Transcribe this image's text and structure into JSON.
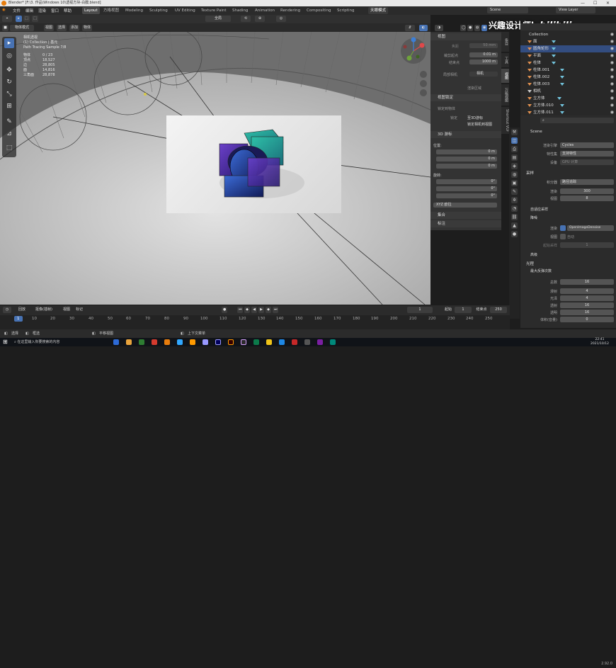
{
  "window": {
    "title": "Blender* [F:\\3. 作品\\Windows 10\\透视方块-白膜.blend]"
  },
  "menu": [
    "文件",
    "编辑",
    "渲染",
    "窗口",
    "帮助"
  ],
  "workspaces": [
    "Layout",
    "方格视图",
    "Modeling",
    "Sculpting",
    "UV Editing",
    "Texture Paint",
    "Shading",
    "Animation",
    "Rendering",
    "Compositing",
    "Scripting"
  ],
  "workspace_extra": "天眼模式",
  "scene": {
    "label": "Scene",
    "view_layer": "View Layer"
  },
  "viewport_header": {
    "mode": "物体模式",
    "view": "视图",
    "select": "选择",
    "add": "添加",
    "object": "物体",
    "orientation": "全局"
  },
  "stats": {
    "title": "相机透视",
    "collection": "(1) Collection | 基元",
    "render": "Path Tracing Sample 7/8",
    "rows": [
      {
        "k": "物体",
        "v": "0 / 23"
      },
      {
        "k": "顶点",
        "v": "18,527"
      },
      {
        "k": "边",
        "v": "28,805"
      },
      {
        "k": "面",
        "v": "14,816"
      },
      {
        "k": "三角面",
        "v": "28,878"
      }
    ]
  },
  "npanel": {
    "view_title": "视图",
    "focal_label": "焦距",
    "focal_value": "50 mm",
    "clip_start_label": "裁剪起点",
    "clip_start": "0.01 m",
    "clip_end_label": "结束点",
    "clip_end": "1000 m",
    "local_camera_label": "局部相机",
    "camera_field": "相机",
    "render_region": "渲染区域",
    "view_lock": "视图锁定",
    "lock_to_object": "锁定到物体",
    "lock_label": "锁定",
    "lock_3d_cursor": "至3D游标",
    "lock_camera_to_view": "锁定相机到视图",
    "cursor_title": "3D 游标",
    "location_label": "位置:",
    "x": "0 m",
    "y": "0 m",
    "z": "0 m",
    "rotation_label": "旋转:",
    "rx": "0°",
    "ry": "0°",
    "rz": "0°",
    "rotation_mode": "XYZ 欧拉",
    "collections": "集合",
    "annotations": "标注"
  },
  "side_tabs": [
    "条目",
    "工具",
    "视图",
    "万能视图",
    "Shortcut VUr"
  ],
  "outliner": {
    "root": "Collection",
    "items": [
      "面",
      "圆角矩形",
      "平面",
      "柱体",
      "柱体.001",
      "柱体.002",
      "柱体.003",
      "相机",
      "立方体",
      "立方体.010",
      "立方体.011"
    ]
  },
  "props": {
    "search_placeholder": "",
    "scene": "Scene",
    "render_engine_label": "渲染引擎",
    "render_engine": "Cycles",
    "feature_set_label": "特性集",
    "feature_set": "支持特性",
    "device_label": "设备",
    "device": "GPU 计算",
    "sampling": "采样",
    "integrator_label": "积分器",
    "integrator": "路径追踪",
    "render_label": "渲染",
    "render_samples": "300",
    "viewport_label": "视图",
    "viewport_samples": "8",
    "adaptive": "自适应采样",
    "denoise": "降噪",
    "denoise_render_label": "渲染",
    "denoiser": "OpenImageDenoise",
    "denoise_viewport_label": "视图",
    "denoise_viewport_field": "自动",
    "start_sample_label": "起始采样",
    "start_sample": "1",
    "advanced": "高级",
    "light_paths": "光程",
    "max_bounces": "最大反弹次数",
    "total_label": "总数",
    "total": "16",
    "diffuse_label": "漫射",
    "diffuse": "4",
    "glossy_label": "光泽",
    "glossy": "4",
    "transmission_label": "透射",
    "transmission": "16",
    "transparency_label": "透明",
    "transparency": "16",
    "volume_label": "体积(音量)",
    "volume": "0"
  },
  "timeline": {
    "playback": "回放",
    "keying": "抠像(插帧)",
    "view": "视图",
    "marker": "标记",
    "current_frame": "1",
    "start_label": "起始",
    "start": "1",
    "end_label": "结束点",
    "end": "250",
    "ticks": [
      "1",
      "10",
      "20",
      "30",
      "40",
      "50",
      "60",
      "70",
      "80",
      "90",
      "100",
      "110",
      "120",
      "130",
      "140",
      "150",
      "160",
      "170",
      "180",
      "190",
      "200",
      "210",
      "220",
      "230",
      "240",
      "250"
    ]
  },
  "statusbar": {
    "select": "选择",
    "box_select": "框选",
    "pan_view": "平移视图",
    "context_menu": "上下文菜单",
    "version": "2.92.0"
  },
  "taskbar": {
    "search": "在这里输入你要搜索的内容",
    "time": "22:41",
    "date": "2021/10/12"
  },
  "watermark": {
    "text": "兴趣设计师k",
    "logo": "bilibili"
  }
}
